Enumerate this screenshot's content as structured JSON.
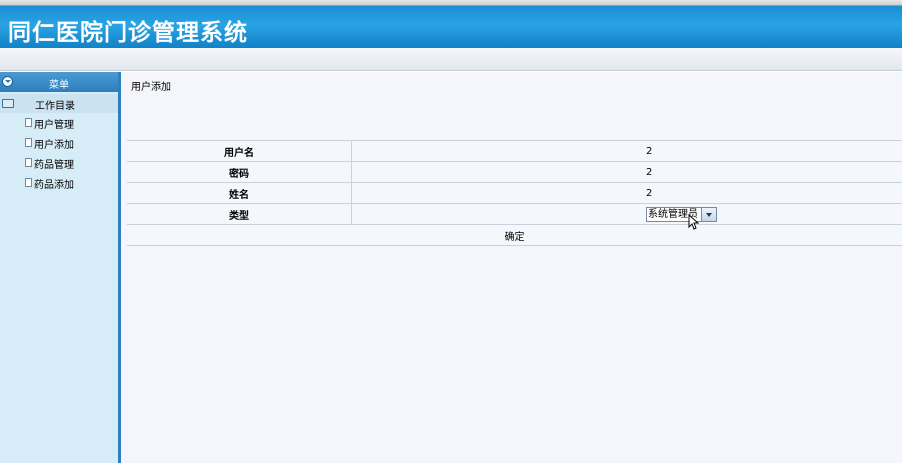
{
  "header": {
    "title": "同仁医院门诊管理系统"
  },
  "sidebar": {
    "menu_label": "菜单",
    "folder_label": "工作目录",
    "items": [
      {
        "label": "用户管理"
      },
      {
        "label": "用户添加"
      },
      {
        "label": "药品管理"
      },
      {
        "label": "药品添加"
      }
    ]
  },
  "main": {
    "page_title": "用户添加",
    "form": {
      "fields": [
        {
          "label": "用户名",
          "value": "2"
        },
        {
          "label": "密码",
          "value": "2"
        },
        {
          "label": "姓名",
          "value": "2"
        },
        {
          "label": "类型",
          "value": "系统管理员"
        }
      ],
      "submit_label": "确定"
    }
  },
  "colors": {
    "banner": "#1a8fd3",
    "sidebar_bg": "#d6ecf6",
    "divider": "#2f7fbd"
  },
  "icons": [
    "collapse-icon",
    "folder-icon",
    "document-icon",
    "dropdown-arrow-icon",
    "mouse-cursor-icon"
  ]
}
